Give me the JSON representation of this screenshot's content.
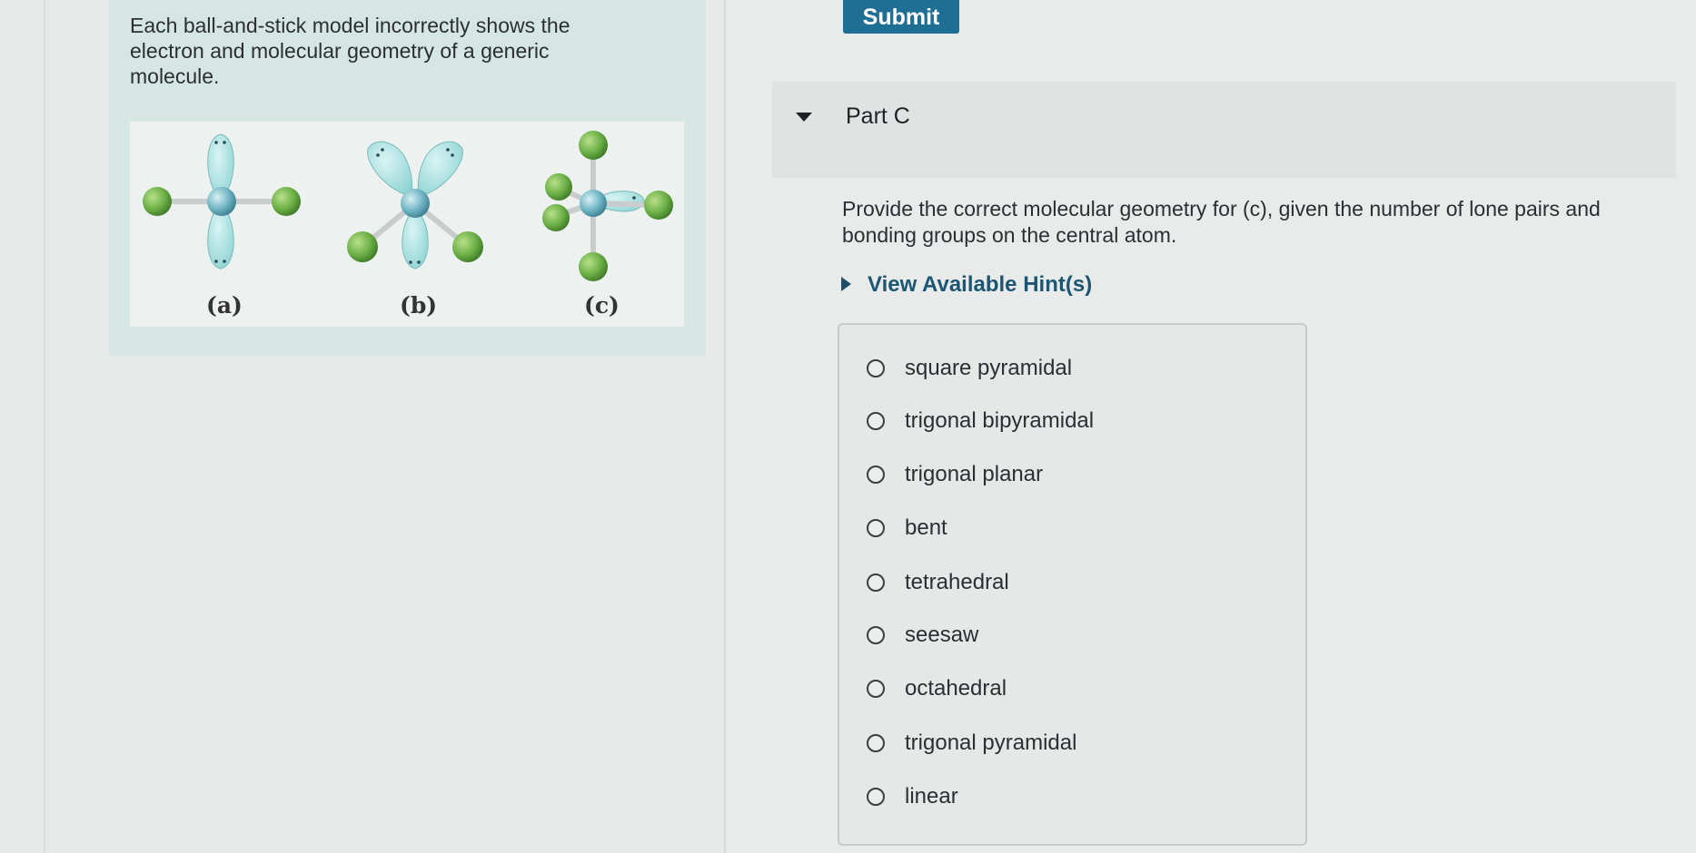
{
  "intro": {
    "text": "Each ball-and-stick model incorrectly shows the electron and molecular geometry of a generic molecule."
  },
  "figure": {
    "labels": [
      "(a)",
      "(b)",
      "(c)"
    ],
    "colors": {
      "central_atom": "#6fb4c4",
      "outer_atom": "#6cb046",
      "lone_pair_lobe": "#9fdcdc",
      "bond": "#c9cccd"
    }
  },
  "toolbar": {
    "submit_label": "Submit"
  },
  "part": {
    "title": "Part C"
  },
  "question": {
    "text": "Provide the correct molecular geometry for (c), given the number of lone pairs and bonding groups on the central atom."
  },
  "hints": {
    "label": "View Available Hint(s)"
  },
  "options": [
    "square pyramidal",
    "trigonal bipyramidal",
    "trigonal planar",
    "bent",
    "tetrahedral",
    "seesaw",
    "octahedral",
    "trigonal pyramidal",
    "linear"
  ],
  "colors": {
    "accent": "#1f6f95",
    "intro_bg": "#d6e6e3",
    "page_bg": "#e9eaea"
  }
}
